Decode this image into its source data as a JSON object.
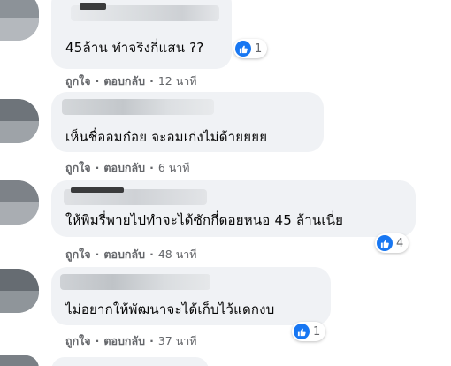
{
  "comments": [
    {
      "text": "45ล้าน ทำจริงกี่แสน ??",
      "like_label": "ถูกใจ",
      "reply_label": "ตอบกลับ",
      "time": "12 นาที",
      "reaction_count": "1",
      "reaction_icon": "like-icon"
    },
    {
      "text": "เห็นชื่ออมก๋อย จะอมเก่งไม่ด้ายยยย",
      "like_label": "ถูกใจ",
      "reply_label": "ตอบกลับ",
      "time": "6 นาที"
    },
    {
      "text": "ให้พิมรี่พายไปทำจะได้ซักกี่ดอยหนอ 45 ล้านเนี่ย",
      "like_label": "ถูกใจ",
      "reply_label": "ตอบกลับ",
      "time": "48 นาที",
      "reaction_count": "4",
      "reaction_icon": "like-icon"
    },
    {
      "text": "ไม่อยากให้พัฒนาจะได้เก็บไว้แดกงบ",
      "like_label": "ถูกใจ",
      "reply_label": "ตอบกลับ",
      "time": "37 นาที",
      "reaction_count": "1",
      "reaction_icon": "like-icon"
    }
  ],
  "colors": {
    "bubble": "#f0f2f5",
    "text": "#050505",
    "meta": "#65676b",
    "like_blue": "#1877f2"
  }
}
